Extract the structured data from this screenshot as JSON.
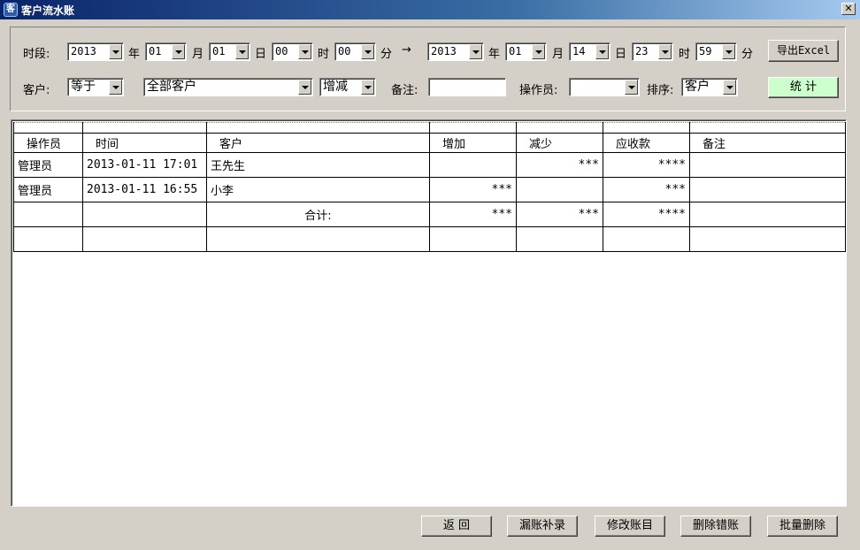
{
  "window": {
    "title": "客户流水账",
    "icon_name": "app-icon",
    "close_label": "✕"
  },
  "filter": {
    "period_label": "时段:",
    "start": {
      "year": "2013",
      "month": "01",
      "day": "01",
      "hour": "00",
      "minute": "00"
    },
    "end": {
      "year": "2013",
      "month": "01",
      "day": "14",
      "hour": "23",
      "minute": "59"
    },
    "unit_year": "年",
    "unit_month": "月",
    "unit_day": "日",
    "unit_hour": "时",
    "unit_minute": "分",
    "arrow": "→",
    "export_label": "导出Excel",
    "customer_label": "客户:",
    "match_op": "等于",
    "customer_value": "全部客户",
    "change_type": "增减",
    "remark_label": "备注:",
    "remark_value": "",
    "operator_label": "操作员:",
    "operator_value": "",
    "sort_label": "排序:",
    "sort_value": "客户",
    "stats_label": "统 计",
    "stats_color": "#ccffcc"
  },
  "grid": {
    "columns": [
      "操作员",
      "时间",
      "客户",
      "增加",
      "减少",
      "应收款",
      "备注"
    ],
    "rows": [
      [
        "管理员",
        "2013-01-11 17:01",
        "王先生",
        "",
        "***",
        "****",
        ""
      ],
      [
        "管理员",
        "2013-01-11 16:55",
        "小李",
        "***",
        "",
        "***",
        ""
      ]
    ],
    "total": {
      "label": "合计:",
      "increase": "***",
      "decrease": "***",
      "receivable": "****"
    }
  },
  "actions": {
    "back": "返 回",
    "add_missing": "漏账补录",
    "edit": "修改账目",
    "delete_error": "删除错账",
    "batch_delete": "批量删除"
  }
}
